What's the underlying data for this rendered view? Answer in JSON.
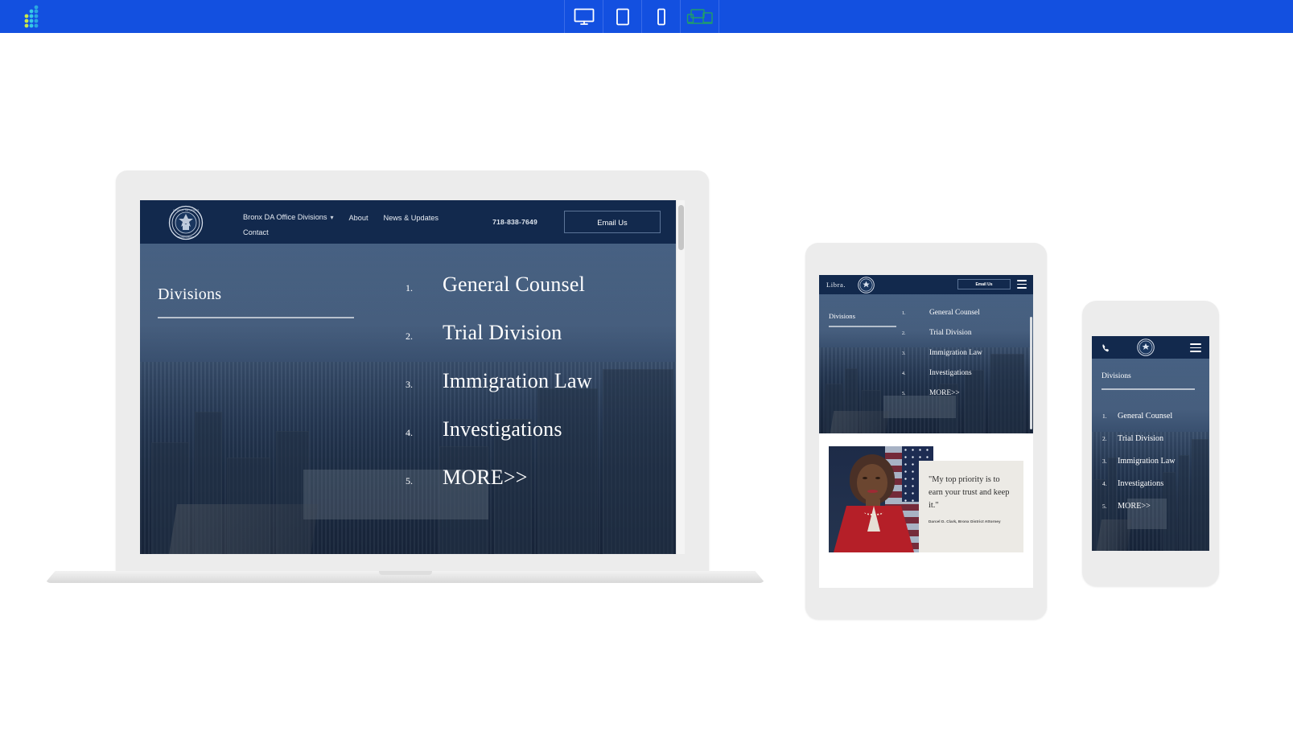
{
  "toolbar": {
    "logo_name": "dot-grid-logo",
    "background": "#1350e0",
    "devices": [
      {
        "id": "desktop",
        "icon": "desktop-monitor-icon",
        "label": "Desktop",
        "active": true
      },
      {
        "id": "tablet",
        "icon": "tablet-icon",
        "label": "Tablet",
        "active": false
      },
      {
        "id": "mobile",
        "icon": "mobile-phone-icon",
        "label": "Mobile",
        "active": false
      },
      {
        "id": "all",
        "icon": "all-devices-icon",
        "label": "All devices",
        "active": false
      }
    ]
  },
  "site": {
    "brand": {
      "wordmark": "Libra.",
      "seal_name": "bronx-district-attorney-seal"
    },
    "nav": {
      "items": [
        {
          "label": "Bronx DA Office Divisions",
          "has_dropdown": true
        },
        {
          "label": "About",
          "has_dropdown": false
        },
        {
          "label": "News & Updates",
          "has_dropdown": false
        },
        {
          "label": "Contact",
          "has_dropdown": false
        }
      ],
      "phone": "718-838-7649",
      "email_button": "Email Us"
    },
    "hero": {
      "section_title": "Divisions",
      "items": [
        {
          "num": "1.",
          "label": "General Counsel"
        },
        {
          "num": "2.",
          "label": "Trial Division"
        },
        {
          "num": "3.",
          "label": "Immigration Law"
        },
        {
          "num": "4.",
          "label": "Investigations"
        },
        {
          "num": "5.",
          "label": "MORE>>"
        }
      ]
    },
    "quote": {
      "text": "\"My top priority is to earn your trust and keep it.\"",
      "attribution": "Darcel D. Clark, Bronx District Attorney"
    }
  },
  "colors": {
    "toolbar_blue": "#1350e0",
    "navy": "#12294d",
    "device_frame": "#ececec",
    "quote_panel": "#eceae5"
  }
}
